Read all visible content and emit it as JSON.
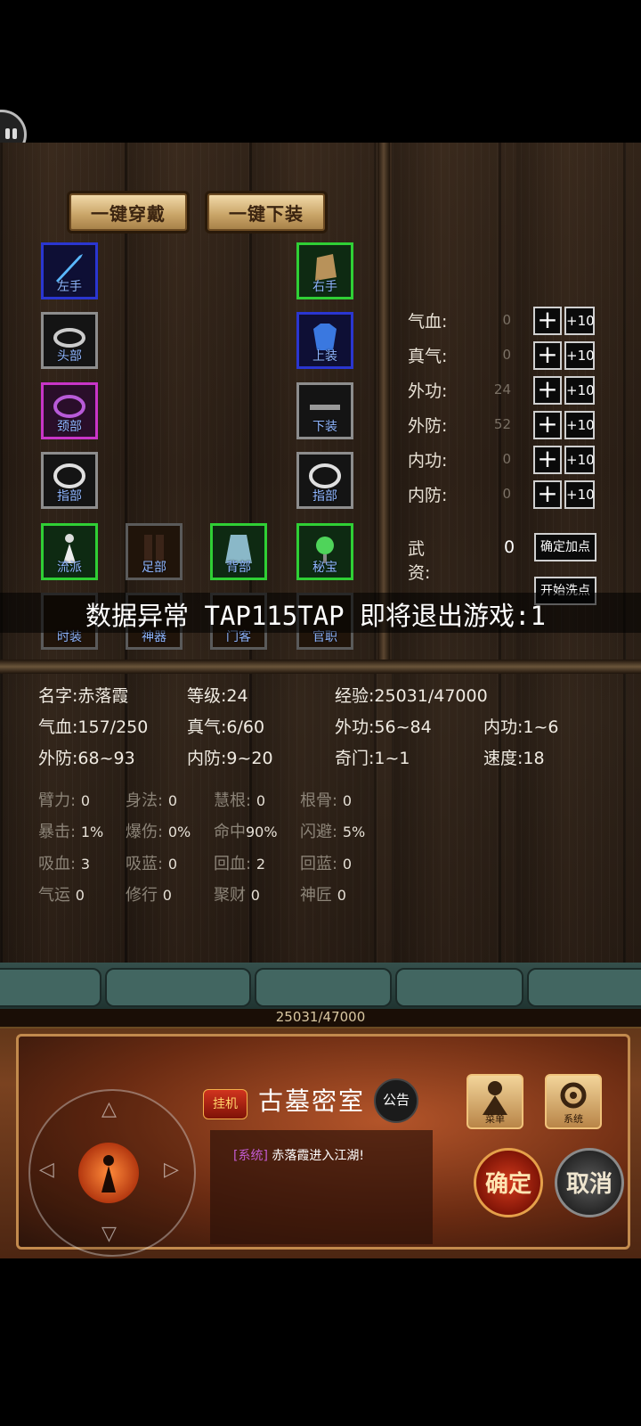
{
  "equip_actions": {
    "wear_all": "一键穿戴",
    "remove_all": "一键下装"
  },
  "slots": {
    "left_hand": "左手",
    "head": "头部",
    "neck": "颈部",
    "finger_left": "指部",
    "school": "流派",
    "foot": "足部",
    "back": "背部",
    "secret": "秘宝",
    "fashion": "时装",
    "artifact": "神器",
    "retainer": "门客",
    "office": "官职",
    "right_hand": "右手",
    "upper": "上装",
    "lower": "下装",
    "finger_right": "指部"
  },
  "attributes": [
    {
      "label": "气血:",
      "value": "0",
      "plus": "+",
      "plus10": "+10"
    },
    {
      "label": "真气:",
      "value": "0",
      "plus": "+",
      "plus10": "+10"
    },
    {
      "label": "外功:",
      "value": "24",
      "plus": "+",
      "plus10": "+10"
    },
    {
      "label": "外防:",
      "value": "52",
      "plus": "+",
      "plus10": "+10"
    },
    {
      "label": "内功:",
      "value": "0",
      "plus": "+",
      "plus10": "+10"
    },
    {
      "label": "内防:",
      "value": "0",
      "plus": "+",
      "plus10": "+10"
    }
  ],
  "wuzi": {
    "label": "武资:",
    "value": "0"
  },
  "point_actions": {
    "confirm": "确定加点",
    "reset": "开始洗点"
  },
  "error_banner": "数据异常 TAP115TAP 即将退出游戏:1",
  "character": {
    "name": "名字:赤落霞",
    "level": "等级:24",
    "exp": "经验:25031/47000",
    "hp": "气血:157/250",
    "mp": "真气:6/60",
    "outer_atk": "外功:56~84",
    "inner_atk": "内功:1~6",
    "outer_def": "外防:68~93",
    "inner_def": "内防:9~20",
    "qimen": "奇门:1~1",
    "speed": "速度:18"
  },
  "secondary_stats": [
    [
      {
        "label": "臂力:",
        "value": "0"
      },
      {
        "label": "身法:",
        "value": "0"
      },
      {
        "label": "慧根:",
        "value": "0"
      },
      {
        "label": "根骨:",
        "value": "0"
      }
    ],
    [
      {
        "label": "暴击:",
        "value": "1%"
      },
      {
        "label": "爆伤:",
        "value": "0%"
      },
      {
        "label": "命中",
        "value": "90%"
      },
      {
        "label": "闪避:",
        "value": "5%"
      }
    ],
    [
      {
        "label": "吸血:",
        "value": "3"
      },
      {
        "label": "吸蓝:",
        "value": "0"
      },
      {
        "label": "回血:",
        "value": "2"
      },
      {
        "label": "回蓝:",
        "value": "0"
      }
    ],
    [
      {
        "label": "气运",
        "value": "0"
      },
      {
        "label": "修行",
        "value": "0"
      },
      {
        "label": "聚财",
        "value": "0"
      },
      {
        "label": "神匠",
        "value": "0"
      }
    ]
  ],
  "hud": {
    "exp_text": "25031/47000",
    "auto_badge": "挂机",
    "map_name": "古墓密室",
    "notice": "公告",
    "chat_tag": "[系统]",
    "chat_text": "赤落霞进入江湖!",
    "menu_label": "菜单",
    "system_label": "系统",
    "confirm": "确定",
    "cancel": "取消"
  }
}
